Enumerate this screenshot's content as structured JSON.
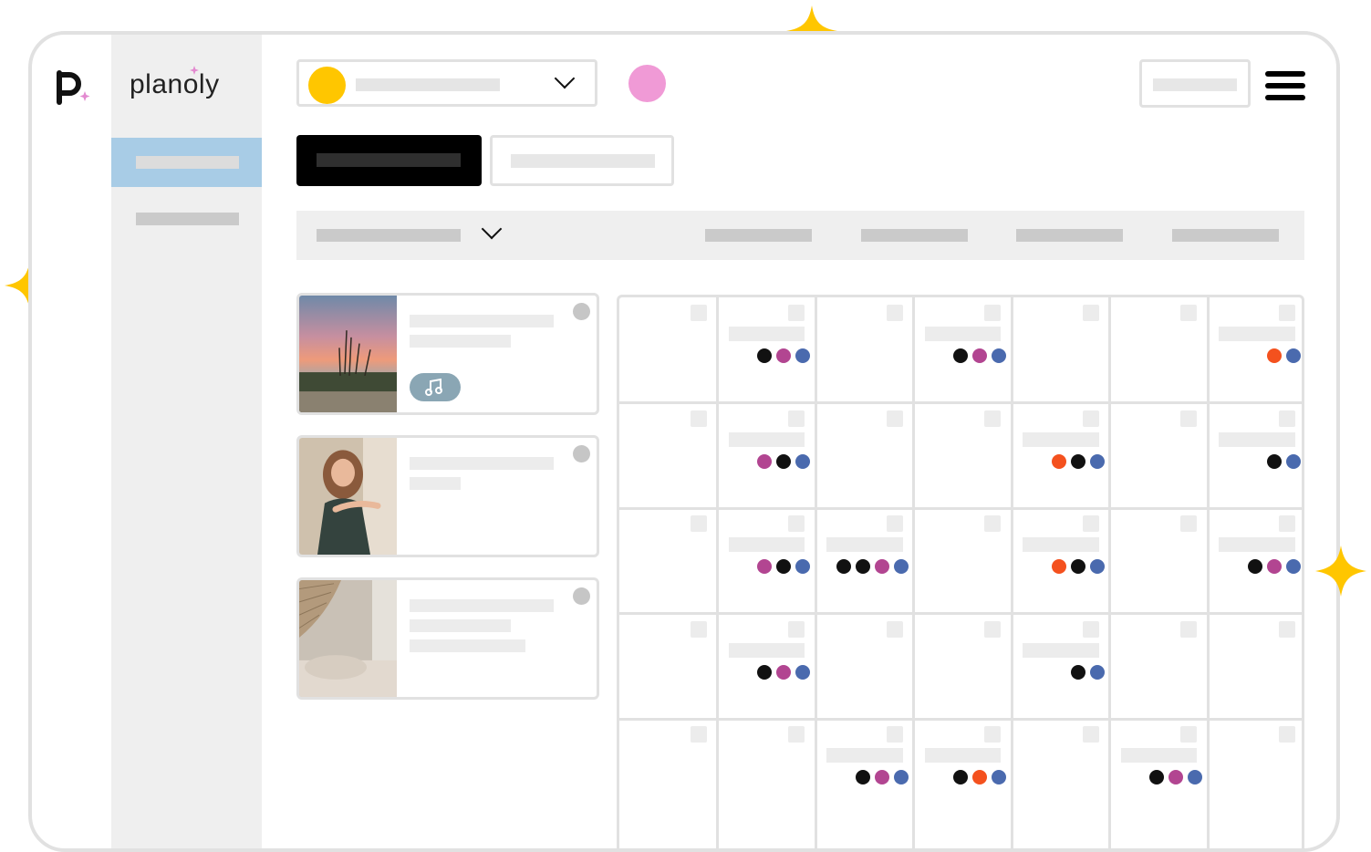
{
  "brand": {
    "name": "planoly"
  },
  "colors": {
    "accent_yellow": "#ffc600",
    "avatar_pink": "#f09ad6",
    "sidebar_active": "#a8cce6",
    "dot_black": "#111111",
    "dot_magenta": "#b24591",
    "dot_blue": "#4a6aae",
    "dot_orange": "#f4511e",
    "audio_chip": "#8aa6b4"
  },
  "icons": {
    "logo": "p-logo-icon",
    "sparkle": "sparkle-icon",
    "chevron": "chevron-down-icon",
    "menu": "hamburger-menu-icon",
    "audio": "music-note-icon"
  },
  "posts": [
    {
      "thumbnail": "sunset-beach",
      "has_audio": true
    },
    {
      "thumbnail": "woman-portrait",
      "has_audio": false
    },
    {
      "thumbnail": "bedroom-decor",
      "has_audio": false
    }
  ],
  "calendar": {
    "rows": 5,
    "columns": 7,
    "cells": [
      [
        [],
        [
          "black",
          "magenta",
          "blue"
        ],
        [],
        [
          "black",
          "magenta",
          "blue"
        ],
        [],
        [],
        [
          "orange",
          "blue"
        ]
      ],
      [
        [],
        [
          "magenta",
          "black",
          "blue"
        ],
        [],
        [],
        [
          "orange",
          "black",
          "blue"
        ],
        [],
        [
          "black",
          "blue"
        ]
      ],
      [
        [],
        [
          "magenta",
          "black",
          "blue"
        ],
        [
          "black",
          "black",
          "magenta",
          "blue"
        ],
        [],
        [
          "orange",
          "black",
          "blue"
        ],
        [],
        [
          "black",
          "magenta",
          "blue"
        ]
      ],
      [
        [],
        [
          "black",
          "magenta",
          "blue"
        ],
        [],
        [],
        [
          "black",
          "blue"
        ],
        [],
        []
      ],
      [
        [],
        [],
        [
          "black",
          "magenta",
          "blue"
        ],
        [
          "black",
          "orange",
          "blue"
        ],
        [],
        [
          "black",
          "magenta",
          "blue"
        ],
        []
      ]
    ]
  }
}
